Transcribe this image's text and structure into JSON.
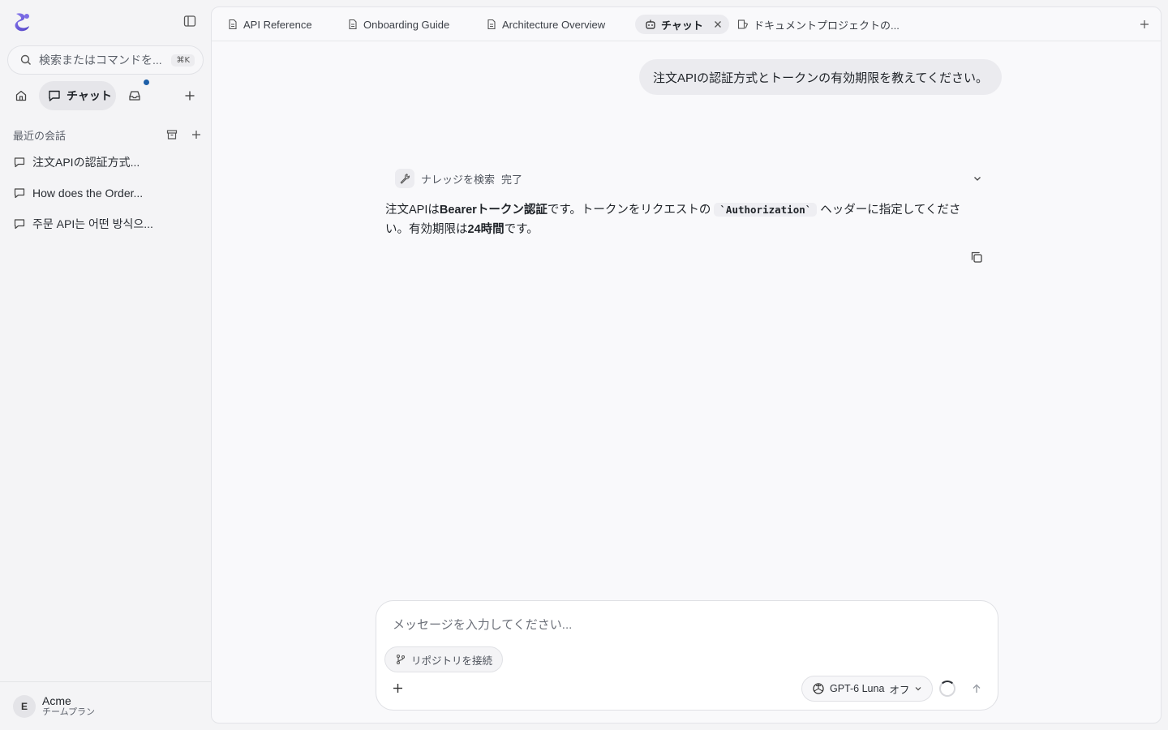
{
  "sidebar": {
    "search_placeholder": "検索またはコマンドを...",
    "search_shortcut": "⌘K",
    "nav_chat_label": "チャット",
    "section_title": "最近の会話",
    "conversations": [
      {
        "title": "注文APIの認証方式..."
      },
      {
        "title": "How does the Order..."
      },
      {
        "title": "주문 API는 어떤 방식으..."
      }
    ],
    "user": {
      "initial": "E",
      "name": "Acme",
      "plan": "チームプラン"
    }
  },
  "tabs": [
    {
      "label": "API Reference",
      "icon": "document-icon"
    },
    {
      "label": "Onboarding Guide",
      "icon": "document-icon"
    },
    {
      "label": "Architecture Overview",
      "icon": "document-icon"
    },
    {
      "label": "チャット",
      "icon": "bot-icon",
      "active": true
    },
    {
      "label": "ドキュメントプロジェクトの...",
      "icon": "project-icon"
    }
  ],
  "chat": {
    "user_message": "注文APIの認証方式とトークンの有効期限を教えてください。",
    "tool": {
      "label": "ナレッジを検索",
      "status": "完了"
    },
    "answer": {
      "p1": "注文APIは",
      "b1": "Bearerトークン認証",
      "p2": "です。トークンをリクエストの",
      "code": "`Authorization`",
      "p3": "ヘッダーに指定してください。有効期限は",
      "b2": "24時間",
      "p4": "です。"
    }
  },
  "composer": {
    "placeholder": "メッセージを入力してください...",
    "repo_button": "リポジトリを接続",
    "model": "GPT-6 Luna",
    "mode": "オフ"
  },
  "colors": {
    "accent_dot": "#1d5fa8",
    "logo": "#6b5bd6"
  }
}
